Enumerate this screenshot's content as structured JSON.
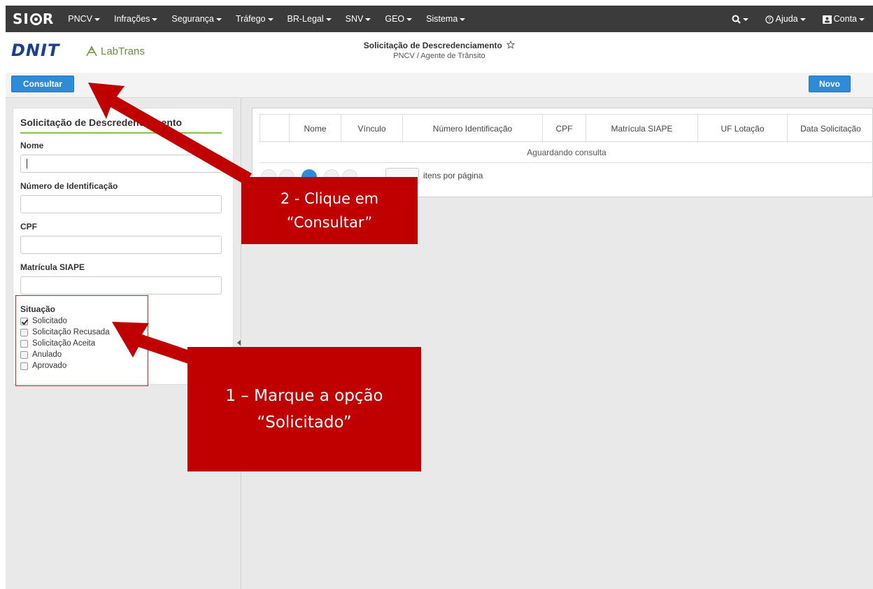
{
  "navbar": {
    "brand": "SIOR",
    "menus": [
      "PNCV",
      "Infrações",
      "Segurança",
      "Tráfego",
      "BR-Legal",
      "SNV",
      "GEO",
      "Sistema"
    ],
    "help": "Ajuda",
    "account": "Conta"
  },
  "header": {
    "logo_primary": "DNIT",
    "logo_secondary": "LabTrans",
    "title": "Solicitação de Descredenciamento",
    "subtitle": "PNCV / Agente de Trânsito"
  },
  "toolbar": {
    "consultar_label": "Consultar",
    "novo_label": "Novo"
  },
  "filter_panel": {
    "title": "Solicitação de Descredenciamento",
    "nome_label": "Nome",
    "nome_value": "",
    "numero_label": "Número de Identificação",
    "numero_value": "",
    "cpf_label": "CPF",
    "cpf_value": "",
    "matricula_label": "Matrícula SIAPE",
    "matricula_value": "",
    "situacao_label": "Situação",
    "situacao_options": [
      {
        "label": "Solicitado",
        "checked": true
      },
      {
        "label": "Solicitação Recusada",
        "checked": false
      },
      {
        "label": "Solicitação Aceita",
        "checked": false
      },
      {
        "label": "Anulado",
        "checked": false
      },
      {
        "label": "Aprovado",
        "checked": false
      }
    ]
  },
  "grid": {
    "columns": [
      "Nome",
      "Vínculo",
      "Número Identificação",
      "CPF",
      "Matrícula SIAPE",
      "UF Lotação",
      "Data Solicitação"
    ],
    "empty_message": "Aguardando consulta",
    "pager_label": "itens por página"
  },
  "annotations": {
    "step2_line1": "2 - Clique em",
    "step2_line2": "“Consultar”",
    "step1_line1": "1 – Marque a opção",
    "step1_line2": "“Solicitado”"
  },
  "colors": {
    "nav_bg": "#3b3b3b",
    "primary_button": "#2f8ad8",
    "annotation_red": "#c00000",
    "panel_accent": "#8bc34a"
  }
}
